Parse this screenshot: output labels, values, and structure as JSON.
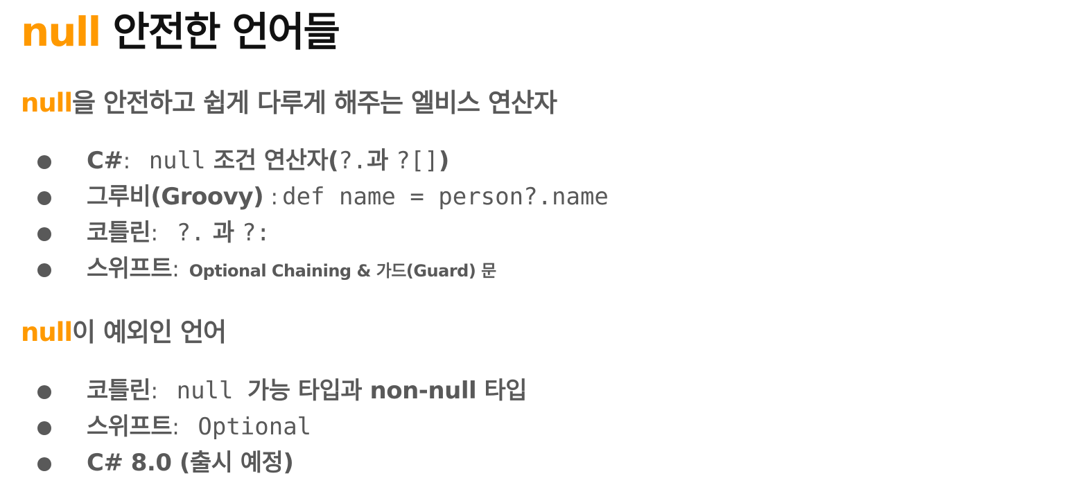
{
  "slide": {
    "title": {
      "accent": "null",
      "rest": " 안전한 언어들"
    },
    "section1": {
      "heading_accent": "null",
      "heading_rest": "을 안전하고 쉽게 다루게 해주는 엘비스 연산자",
      "items": [
        {
          "label": "C#",
          "colon": ":",
          "code": " null",
          "after": " 조건 연산자(",
          "code2": "?.",
          "after2": "과 ",
          "code3": "?[]",
          "after3": ")"
        },
        {
          "label": "그루비(Groovy)",
          "colon": " :",
          "code": "def name = person?.name"
        },
        {
          "label": "코틀린",
          "colon": ":",
          "code": " ?.",
          "after": " 과 ",
          "code2": "?:"
        },
        {
          "label": "스위프트",
          "colon": ":",
          "small": " Optional Chaining & 가드(Guard) 문"
        }
      ]
    },
    "section2": {
      "heading_accent": "null",
      "heading_rest": "이 예외인 언어",
      "items": [
        {
          "label": "코틀린",
          "colon": ":",
          "code": " null ",
          "after": " 가능 타입과 non-null 타입"
        },
        {
          "label": "스위프트",
          "colon": ":",
          "code": " Optional"
        },
        {
          "label": "C# 8.0 (출시 예정)"
        }
      ]
    }
  },
  "colors": {
    "accent": "#ff9900",
    "title": "#111111",
    "body": "#595959"
  }
}
